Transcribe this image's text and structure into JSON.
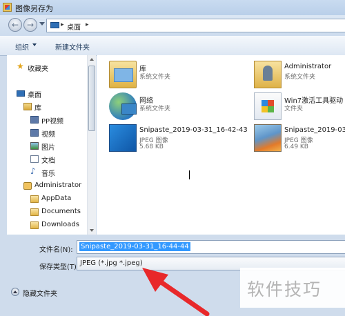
{
  "window": {
    "title": "图像另存为"
  },
  "address": {
    "crumb": "桌面",
    "sep": "▸"
  },
  "toolbar": {
    "organize": "组织",
    "new_folder": "新建文件夹"
  },
  "nav": {
    "favorites": "收藏夹",
    "desktop": "桌面",
    "libraries": "库",
    "pp_video": "PP视频",
    "video": "视频",
    "pictures": "图片",
    "documents_lib": "文档",
    "music": "音乐",
    "administrator": "Administrator",
    "appdata": "AppData",
    "documents": "Documents",
    "downloads": "Downloads"
  },
  "files": [
    {
      "name": "库",
      "type": "系统文件夹",
      "size": "",
      "icon": "library-icon"
    },
    {
      "name": "Administrator",
      "type": "系统文件夹",
      "size": "",
      "icon": "user-folder-icon"
    },
    {
      "name": "网络",
      "type": "系统文件夹",
      "size": "",
      "icon": "network-icon"
    },
    {
      "name": "Win7激活工具驱动",
      "type": "文件夹",
      "size": "",
      "icon": "folder-icon"
    },
    {
      "name": "Snipaste_2019-03-31_16-42-43",
      "type": "JPEG 图像",
      "size": "5.68 KB",
      "icon": "jpeg-icon"
    },
    {
      "name": "Snipaste_2019-03-",
      "type": "JPEG 图像",
      "size": "6.49 KB",
      "icon": "jpeg-icon"
    }
  ],
  "form": {
    "filename_label": "文件名(N):",
    "filename_value": "Snipaste_2019-03-31_16-44-44",
    "filetype_label": "保存类型(T):",
    "filetype_value": "JPEG (*.jpg *.jpeg)"
  },
  "footer": {
    "hide_folders": "隐藏文件夹"
  },
  "watermark": "软件技巧",
  "colors": {
    "selection": "#3399ff",
    "arrow": "#e8282a"
  }
}
